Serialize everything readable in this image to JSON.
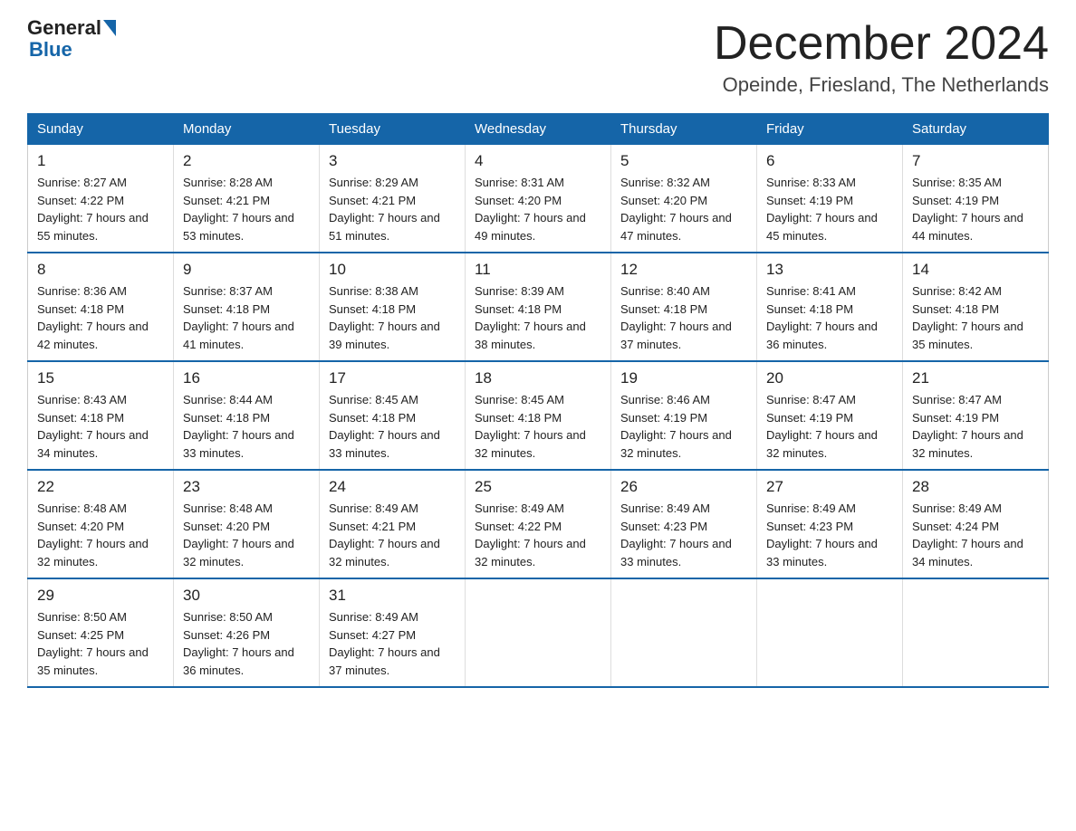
{
  "header": {
    "logo_general": "General",
    "logo_blue": "Blue",
    "month": "December 2024",
    "location": "Opeinde, Friesland, The Netherlands"
  },
  "weekdays": [
    "Sunday",
    "Monday",
    "Tuesday",
    "Wednesday",
    "Thursday",
    "Friday",
    "Saturday"
  ],
  "weeks": [
    [
      {
        "day": "1",
        "sunrise": "8:27 AM",
        "sunset": "4:22 PM",
        "daylight": "7 hours and 55 minutes."
      },
      {
        "day": "2",
        "sunrise": "8:28 AM",
        "sunset": "4:21 PM",
        "daylight": "7 hours and 53 minutes."
      },
      {
        "day": "3",
        "sunrise": "8:29 AM",
        "sunset": "4:21 PM",
        "daylight": "7 hours and 51 minutes."
      },
      {
        "day": "4",
        "sunrise": "8:31 AM",
        "sunset": "4:20 PM",
        "daylight": "7 hours and 49 minutes."
      },
      {
        "day": "5",
        "sunrise": "8:32 AM",
        "sunset": "4:20 PM",
        "daylight": "7 hours and 47 minutes."
      },
      {
        "day": "6",
        "sunrise": "8:33 AM",
        "sunset": "4:19 PM",
        "daylight": "7 hours and 45 minutes."
      },
      {
        "day": "7",
        "sunrise": "8:35 AM",
        "sunset": "4:19 PM",
        "daylight": "7 hours and 44 minutes."
      }
    ],
    [
      {
        "day": "8",
        "sunrise": "8:36 AM",
        "sunset": "4:18 PM",
        "daylight": "7 hours and 42 minutes."
      },
      {
        "day": "9",
        "sunrise": "8:37 AM",
        "sunset": "4:18 PM",
        "daylight": "7 hours and 41 minutes."
      },
      {
        "day": "10",
        "sunrise": "8:38 AM",
        "sunset": "4:18 PM",
        "daylight": "7 hours and 39 minutes."
      },
      {
        "day": "11",
        "sunrise": "8:39 AM",
        "sunset": "4:18 PM",
        "daylight": "7 hours and 38 minutes."
      },
      {
        "day": "12",
        "sunrise": "8:40 AM",
        "sunset": "4:18 PM",
        "daylight": "7 hours and 37 minutes."
      },
      {
        "day": "13",
        "sunrise": "8:41 AM",
        "sunset": "4:18 PM",
        "daylight": "7 hours and 36 minutes."
      },
      {
        "day": "14",
        "sunrise": "8:42 AM",
        "sunset": "4:18 PM",
        "daylight": "7 hours and 35 minutes."
      }
    ],
    [
      {
        "day": "15",
        "sunrise": "8:43 AM",
        "sunset": "4:18 PM",
        "daylight": "7 hours and 34 minutes."
      },
      {
        "day": "16",
        "sunrise": "8:44 AM",
        "sunset": "4:18 PM",
        "daylight": "7 hours and 33 minutes."
      },
      {
        "day": "17",
        "sunrise": "8:45 AM",
        "sunset": "4:18 PM",
        "daylight": "7 hours and 33 minutes."
      },
      {
        "day": "18",
        "sunrise": "8:45 AM",
        "sunset": "4:18 PM",
        "daylight": "7 hours and 32 minutes."
      },
      {
        "day": "19",
        "sunrise": "8:46 AM",
        "sunset": "4:19 PM",
        "daylight": "7 hours and 32 minutes."
      },
      {
        "day": "20",
        "sunrise": "8:47 AM",
        "sunset": "4:19 PM",
        "daylight": "7 hours and 32 minutes."
      },
      {
        "day": "21",
        "sunrise": "8:47 AM",
        "sunset": "4:19 PM",
        "daylight": "7 hours and 32 minutes."
      }
    ],
    [
      {
        "day": "22",
        "sunrise": "8:48 AM",
        "sunset": "4:20 PM",
        "daylight": "7 hours and 32 minutes."
      },
      {
        "day": "23",
        "sunrise": "8:48 AM",
        "sunset": "4:20 PM",
        "daylight": "7 hours and 32 minutes."
      },
      {
        "day": "24",
        "sunrise": "8:49 AM",
        "sunset": "4:21 PM",
        "daylight": "7 hours and 32 minutes."
      },
      {
        "day": "25",
        "sunrise": "8:49 AM",
        "sunset": "4:22 PM",
        "daylight": "7 hours and 32 minutes."
      },
      {
        "day": "26",
        "sunrise": "8:49 AM",
        "sunset": "4:23 PM",
        "daylight": "7 hours and 33 minutes."
      },
      {
        "day": "27",
        "sunrise": "8:49 AM",
        "sunset": "4:23 PM",
        "daylight": "7 hours and 33 minutes."
      },
      {
        "day": "28",
        "sunrise": "8:49 AM",
        "sunset": "4:24 PM",
        "daylight": "7 hours and 34 minutes."
      }
    ],
    [
      {
        "day": "29",
        "sunrise": "8:50 AM",
        "sunset": "4:25 PM",
        "daylight": "7 hours and 35 minutes."
      },
      {
        "day": "30",
        "sunrise": "8:50 AM",
        "sunset": "4:26 PM",
        "daylight": "7 hours and 36 minutes."
      },
      {
        "day": "31",
        "sunrise": "8:49 AM",
        "sunset": "4:27 PM",
        "daylight": "7 hours and 37 minutes."
      },
      null,
      null,
      null,
      null
    ]
  ]
}
